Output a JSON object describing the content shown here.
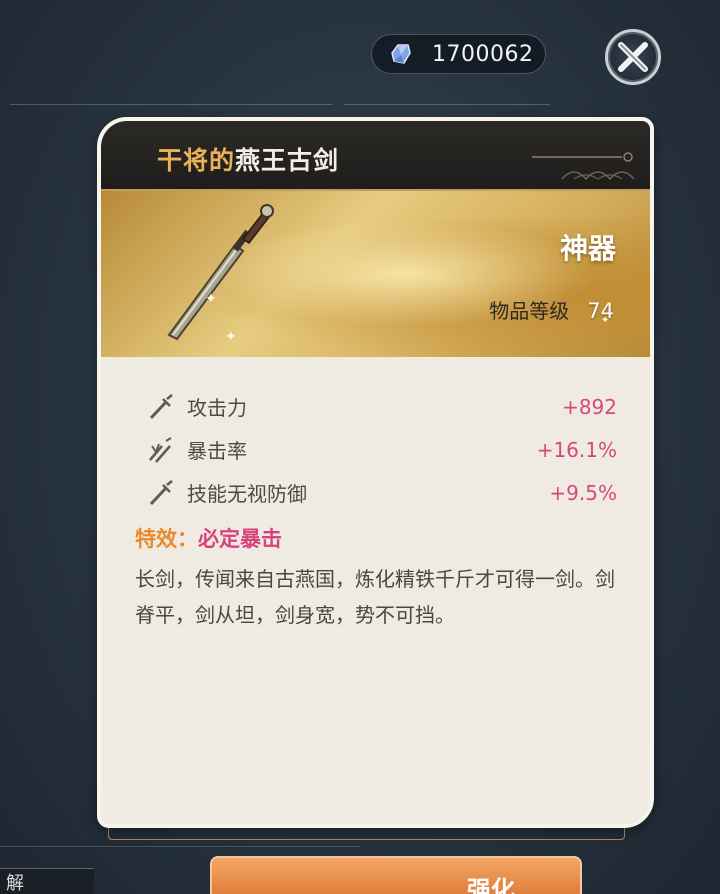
{
  "topbar": {
    "currency_value": "1700062",
    "currency_icon": "gem-icon",
    "close_icon": "close-x-icon"
  },
  "item": {
    "name_prefix": "干将的",
    "name_main": "燕王古剑",
    "rarity": "神器",
    "level_label": "物品等级",
    "level_value": "74"
  },
  "stats": [
    {
      "icon": "sword-icon",
      "name": "攻击力",
      "value": "+892"
    },
    {
      "icon": "crit-icon",
      "name": "暴击率",
      "value": "+16.1%"
    },
    {
      "icon": "sword-icon",
      "name": "技能无视防御",
      "value": "+9.5%"
    }
  ],
  "effect": {
    "label": "特效：",
    "value": "必定暴击"
  },
  "description": "长剑，传闻来自古燕国，炼化精铁千斤才可得一剑。剑脊平，剑从坦，剑身宽，势不可挡。",
  "bottom": {
    "left_partial_label": "解",
    "enhance_label": "强化"
  },
  "colors": {
    "stat_value": "#d8487a",
    "effect_label": "#e88a2b",
    "name_prefix": "#eab158",
    "banner_gold": "#d5ad5b"
  }
}
